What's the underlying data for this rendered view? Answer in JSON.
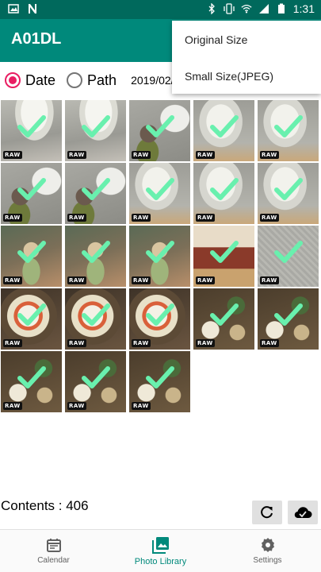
{
  "status_bar": {
    "time": "1:31",
    "left_icons": [
      "image-icon",
      "n-logo-icon"
    ],
    "right_icons": [
      "bluetooth-icon",
      "vibrate-icon",
      "wifi-icon",
      "signal-icon",
      "battery-icon"
    ]
  },
  "app_bar": {
    "title": "A01DL"
  },
  "filter": {
    "options": [
      {
        "label": "Date",
        "selected": true
      },
      {
        "label": "Path",
        "selected": false
      }
    ],
    "date_value": "2019/02/"
  },
  "overflow_menu": {
    "items": [
      "Original Size",
      "Small Size(JPEG)"
    ]
  },
  "photos": [
    {
      "kind": "icecream",
      "raw": true,
      "checked": true
    },
    {
      "kind": "icecream",
      "raw": true,
      "checked": true
    },
    {
      "kind": "figure",
      "raw": true,
      "checked": true
    },
    {
      "kind": "cone",
      "raw": true,
      "checked": true
    },
    {
      "kind": "cone",
      "raw": true,
      "checked": true
    },
    {
      "kind": "figure",
      "raw": true,
      "checked": true
    },
    {
      "kind": "figure",
      "raw": true,
      "checked": true
    },
    {
      "kind": "cone",
      "raw": true,
      "checked": true
    },
    {
      "kind": "cone",
      "raw": true,
      "checked": true
    },
    {
      "kind": "cone",
      "raw": true,
      "checked": true
    },
    {
      "kind": "doll",
      "raw": true,
      "checked": true
    },
    {
      "kind": "doll",
      "raw": true,
      "checked": true
    },
    {
      "kind": "doll",
      "raw": true,
      "checked": true
    },
    {
      "kind": "room",
      "raw": true,
      "checked": true
    },
    {
      "kind": "paper",
      "raw": true,
      "checked": true
    },
    {
      "kind": "food",
      "raw": true,
      "checked": true
    },
    {
      "kind": "food",
      "raw": true,
      "checked": true
    },
    {
      "kind": "food",
      "raw": true,
      "checked": true
    },
    {
      "kind": "meal",
      "raw": true,
      "checked": true
    },
    {
      "kind": "meal",
      "raw": true,
      "checked": true
    },
    {
      "kind": "meal",
      "raw": true,
      "checked": true
    },
    {
      "kind": "meal",
      "raw": true,
      "checked": true
    },
    {
      "kind": "meal",
      "raw": true,
      "checked": true
    }
  ],
  "raw_badge": "RAW",
  "footer": {
    "contents_label": "Contents : 406"
  },
  "bottom_nav": [
    {
      "label": "Calendar",
      "icon": "calendar-icon",
      "active": false
    },
    {
      "label": "Photo Library",
      "icon": "photo-library-icon",
      "active": true
    },
    {
      "label": "Settings",
      "icon": "gear-icon",
      "active": false
    }
  ],
  "colors": {
    "primary": "#00897b",
    "primary_dark": "#00695c",
    "accent": "#e91e63",
    "check": "#69f0ae"
  }
}
